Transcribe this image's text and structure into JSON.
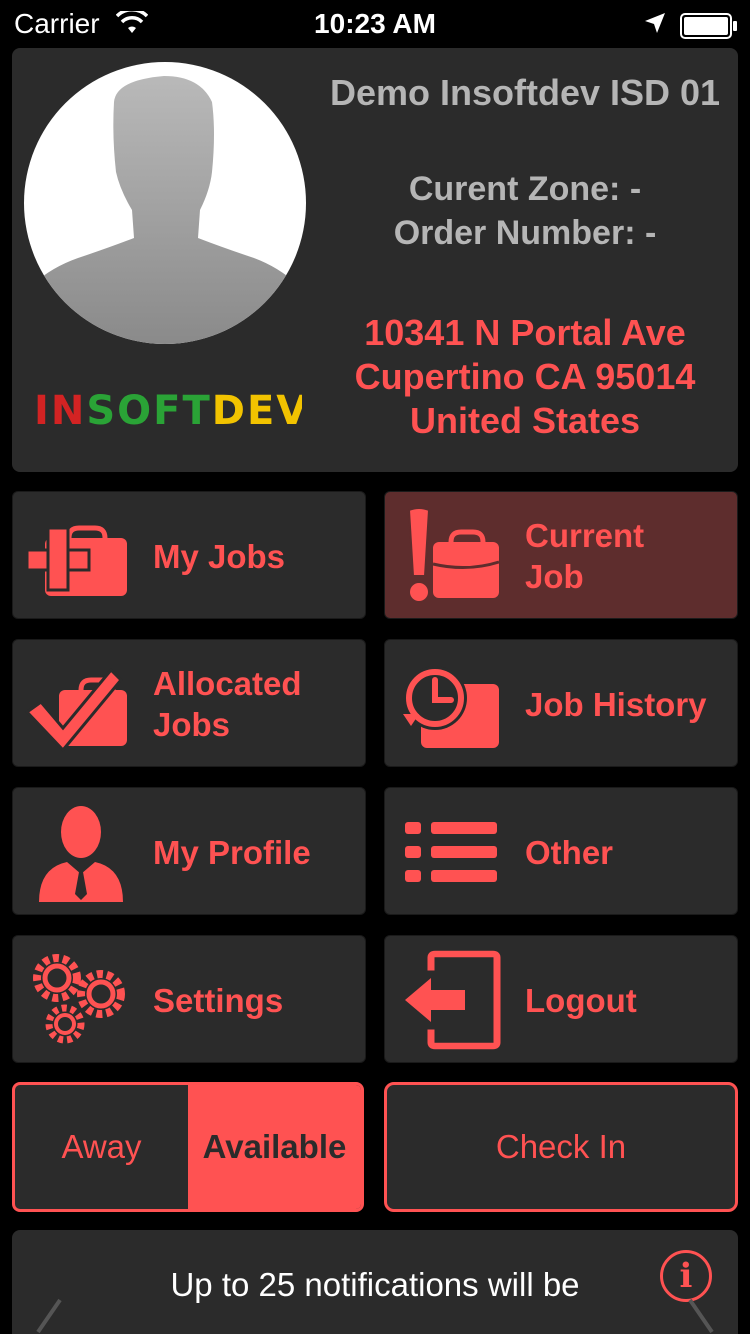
{
  "status_bar": {
    "carrier": "Carrier",
    "time": "10:23 AM"
  },
  "header": {
    "user_name": "Demo Insoftdev ISD 01",
    "zone": "Curent Zone: -",
    "order": "Order Number: -",
    "address": [
      "10341 N Portal Ave",
      "Cupertino CA 95014",
      "United States"
    ],
    "logo_text": "INSOFTDEV"
  },
  "menu": {
    "my_jobs": "My Jobs",
    "current_job": [
      "Current",
      "Job"
    ],
    "allocated_jobs": [
      "Allocated",
      "Jobs"
    ],
    "job_history": "Job History",
    "my_profile": "My Profile",
    "other": "Other",
    "settings": "Settings",
    "logout": "Logout"
  },
  "availability": {
    "away": "Away",
    "available": "Available",
    "selected": "available"
  },
  "check_in": "Check In",
  "notification": {
    "text": "Up to 25 notifications will be",
    "info_glyph": "i"
  },
  "colors": {
    "accent": "#ff5252",
    "card": "#2b2b2b",
    "active_tile": "#5e2d2d",
    "muted_text": "#b5b5b5"
  }
}
